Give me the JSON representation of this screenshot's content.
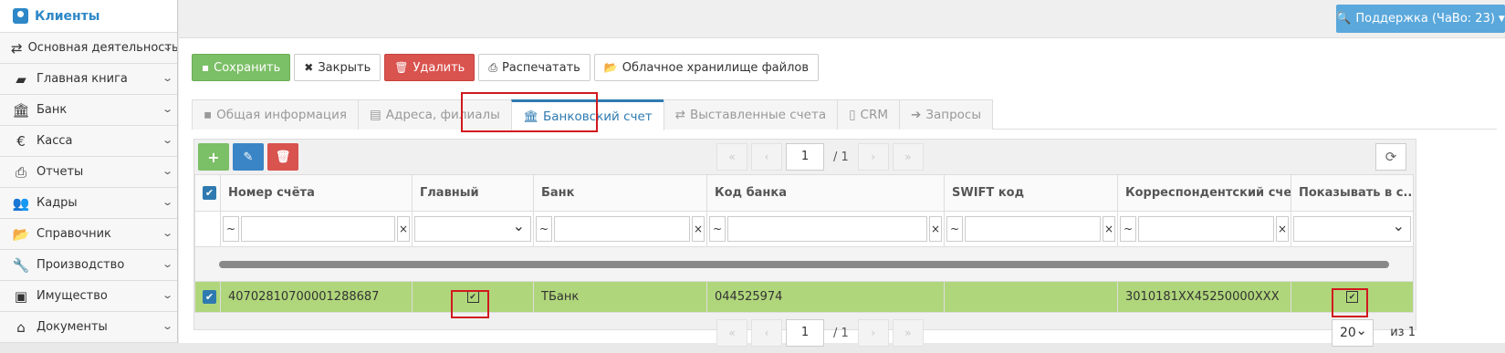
{
  "sidebar": {
    "header": "Клиенты",
    "items": [
      {
        "label": "Основная деятельность",
        "icon": "arrows-exchange-icon",
        "glyph": "⇄"
      },
      {
        "label": "Главная книга",
        "icon": "book-icon",
        "glyph": "▰"
      },
      {
        "label": "Банк",
        "icon": "bank-icon",
        "glyph": "🏛"
      },
      {
        "label": "Касса",
        "icon": "euro-icon",
        "glyph": "€"
      },
      {
        "label": "Отчеты",
        "icon": "printer-icon",
        "glyph": "⎙"
      },
      {
        "label": "Кадры",
        "icon": "users-icon",
        "glyph": "👥"
      },
      {
        "label": "Справочник",
        "icon": "folder-open-icon",
        "glyph": "📂"
      },
      {
        "label": "Производство",
        "icon": "wrench-icon",
        "glyph": "🔧"
      },
      {
        "label": "Имущество",
        "icon": "cube-icon",
        "glyph": "▣"
      },
      {
        "label": "Документы",
        "icon": "inbox-icon",
        "glyph": "⌂"
      }
    ]
  },
  "topbar": {
    "support_label": "Поддержка (ЧаВо: 23)"
  },
  "toolbar": {
    "save": "Сохранить",
    "close": "Закрыть",
    "delete": "Удалить",
    "print": "Распечатать",
    "cloud": "Облачное хранилище файлов"
  },
  "tabs": [
    {
      "label": "Общая информация"
    },
    {
      "label": "Адреса, филиалы"
    },
    {
      "label": "Банковский счет"
    },
    {
      "label": "Выставленные счета"
    },
    {
      "label": "CRM"
    },
    {
      "label": "Запросы"
    }
  ],
  "grid": {
    "pager": {
      "page": "1",
      "total": "/ 1"
    },
    "columns": [
      "Номер счёта",
      "Главный",
      "Банк",
      "Код банка",
      "SWIFT код",
      "Корреспондентский счет",
      "Показывать в с..."
    ],
    "filter_op": "~",
    "filter_clear": "×",
    "rows": [
      {
        "account": "40702810700001288687",
        "bank": "ТБанк",
        "bank_code": "044525974",
        "swift": "",
        "corr": "3010181XX45250000XXX"
      }
    ],
    "page_size": "20",
    "page_of": "из 1"
  }
}
